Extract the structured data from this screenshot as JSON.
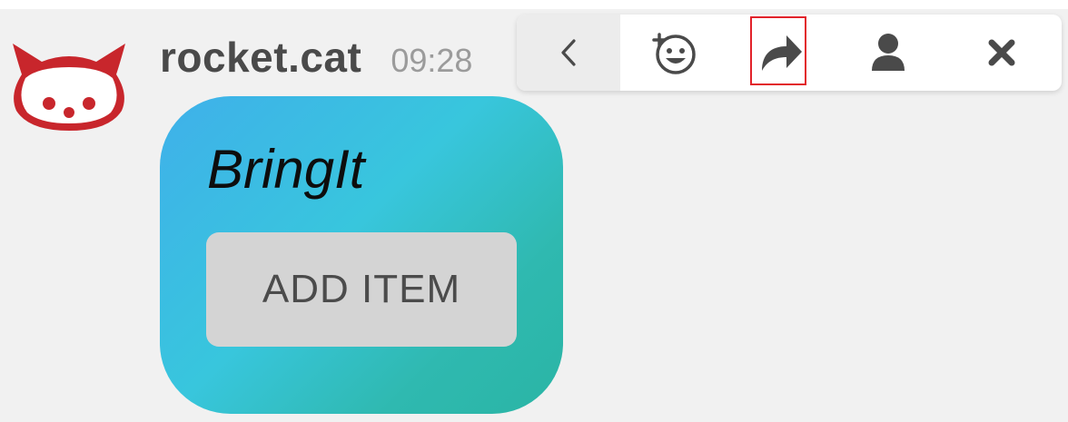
{
  "message": {
    "username": "rocket.cat",
    "timestamp": "09:28",
    "avatar_icon": "rocket-cat-icon"
  },
  "card": {
    "title": "BringIt",
    "button_label": "ADD ITEM",
    "gradient_colors": [
      "#3fb0ea",
      "#38c6dd",
      "#2ab5a5"
    ]
  },
  "toolbar": {
    "actions": [
      {
        "name": "back",
        "icon": "chevron-left-icon"
      },
      {
        "name": "add-reaction",
        "icon": "emoji-add-icon"
      },
      {
        "name": "forward",
        "icon": "forward-arrow-icon",
        "highlighted": true
      },
      {
        "name": "user",
        "icon": "user-icon"
      },
      {
        "name": "close",
        "icon": "close-icon"
      }
    ],
    "highlight_color": "#e2222a"
  }
}
